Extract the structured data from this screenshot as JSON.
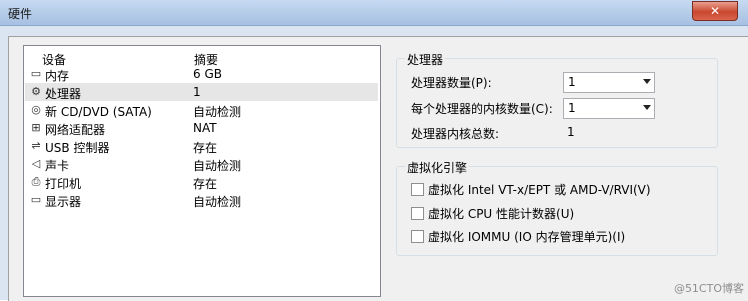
{
  "window": {
    "title": "硬件",
    "close_label": "✕"
  },
  "device_list": {
    "col_device": "设备",
    "col_summary": "摘要",
    "rows": [
      {
        "icon": "memory-icon",
        "name": "内存",
        "summary": "6 GB"
      },
      {
        "icon": "processor-icon",
        "name": "处理器",
        "summary": "1"
      },
      {
        "icon": "cd-dvd-icon",
        "name": "新 CD/DVD (SATA)",
        "summary": "自动检测"
      },
      {
        "icon": "network-adapter-icon",
        "name": "网络适配器",
        "summary": "NAT"
      },
      {
        "icon": "usb-icon",
        "name": "USB 控制器",
        "summary": "存在"
      },
      {
        "icon": "sound-card-icon",
        "name": "声卡",
        "summary": "自动检测"
      },
      {
        "icon": "printer-icon",
        "name": "打印机",
        "summary": "存在"
      },
      {
        "icon": "display-icon",
        "name": "显示器",
        "summary": "自动检测"
      }
    ],
    "selected_index": 1
  },
  "processor_group": {
    "title": "处理器",
    "count_label": "处理器数量(P):",
    "count_value": "1",
    "cores_label": "每个处理器的内核数量(C):",
    "cores_value": "1",
    "total_label": "处理器内核总数:",
    "total_value": "1"
  },
  "virtualization_group": {
    "title": "虚拟化引擎",
    "options": [
      {
        "label": "虚拟化 Intel VT-x/EPT 或 AMD-V/RVI(V)",
        "checked": false
      },
      {
        "label": "虚拟化 CPU 性能计数器(U)",
        "checked": false
      },
      {
        "label": "虚拟化 IOMMU (IO 内存管理单元)(I)",
        "checked": false
      }
    ]
  },
  "watermark": "@51CTO博客"
}
